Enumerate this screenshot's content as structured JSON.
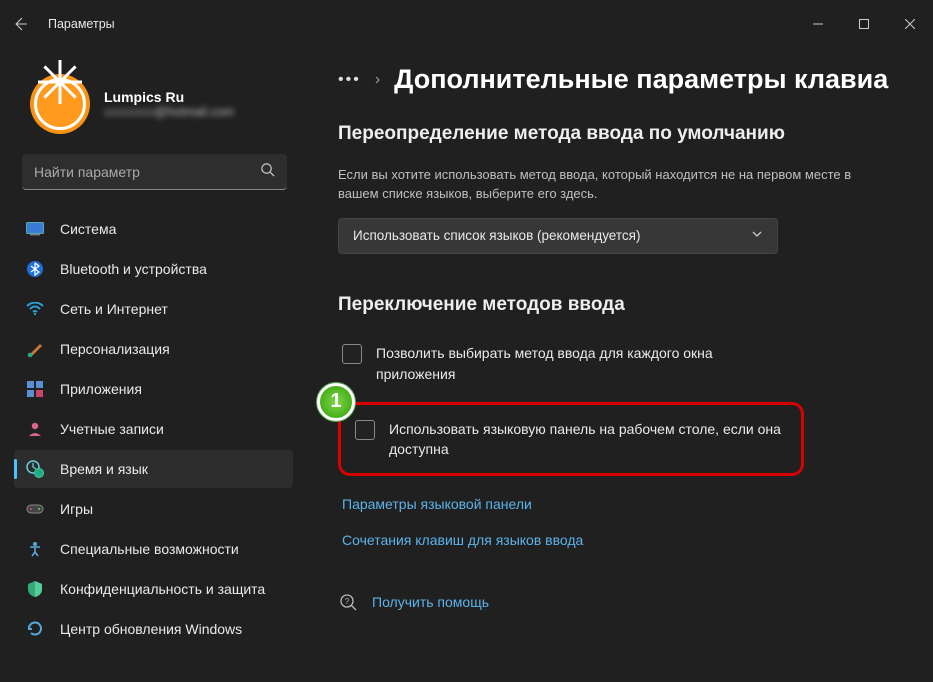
{
  "window": {
    "title": "Параметры"
  },
  "profile": {
    "name": "Lumpics Ru",
    "email_suffix": "@hotmail.com"
  },
  "search": {
    "placeholder": "Найти параметр"
  },
  "sidebar": {
    "items": [
      {
        "label": "Система",
        "icon": "system"
      },
      {
        "label": "Bluetooth и устройства",
        "icon": "bluetooth"
      },
      {
        "label": "Сеть и Интернет",
        "icon": "wifi"
      },
      {
        "label": "Персонализация",
        "icon": "brush"
      },
      {
        "label": "Приложения",
        "icon": "apps"
      },
      {
        "label": "Учетные записи",
        "icon": "account"
      },
      {
        "label": "Время и язык",
        "icon": "clock"
      },
      {
        "label": "Игры",
        "icon": "games"
      },
      {
        "label": "Специальные возможности",
        "icon": "accessibility"
      },
      {
        "label": "Конфиденциальность и защита",
        "icon": "shield"
      },
      {
        "label": "Центр обновления Windows",
        "icon": "update"
      }
    ],
    "selected_index": 6
  },
  "breadcrumb": {
    "ellipsis": "•••",
    "sep": "›",
    "title": "Дополнительные параметры клавиа"
  },
  "section1": {
    "heading": "Переопределение метода ввода по умолчанию",
    "desc": "Если вы хотите использовать метод ввода, который находится не на первом месте в вашем списке языков, выберите его здесь.",
    "dropdown_value": "Использовать список языков (рекомендуется)"
  },
  "section2": {
    "heading": "Переключение методов ввода",
    "check1": "Позволить выбирать метод ввода для каждого окна приложения",
    "check2": "Использовать языковую панель на рабочем столе, если она доступна",
    "link1": "Параметры языковой панели",
    "link2": "Сочетания клавиш для языков ввода"
  },
  "help": {
    "label": "Получить помощь"
  },
  "annotation": {
    "step": "1"
  }
}
